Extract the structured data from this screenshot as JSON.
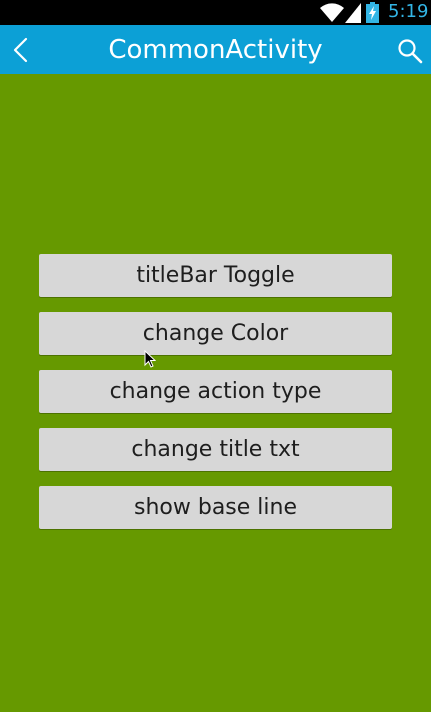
{
  "status_bar": {
    "time": "5:19",
    "icons": [
      "wifi-icon",
      "signal-icon",
      "battery-charging-icon"
    ],
    "accent_color": "#33b5e5"
  },
  "title_bar": {
    "title": "CommonActivity",
    "left_icon": "back-icon",
    "right_icon": "search-icon",
    "background_color": "#0ca0d6"
  },
  "content": {
    "background_color": "#669900",
    "buttons": [
      {
        "label": "titleBar Toggle"
      },
      {
        "label": "change Color"
      },
      {
        "label": "change action type"
      },
      {
        "label": "change title txt"
      },
      {
        "label": "show base line"
      }
    ]
  }
}
